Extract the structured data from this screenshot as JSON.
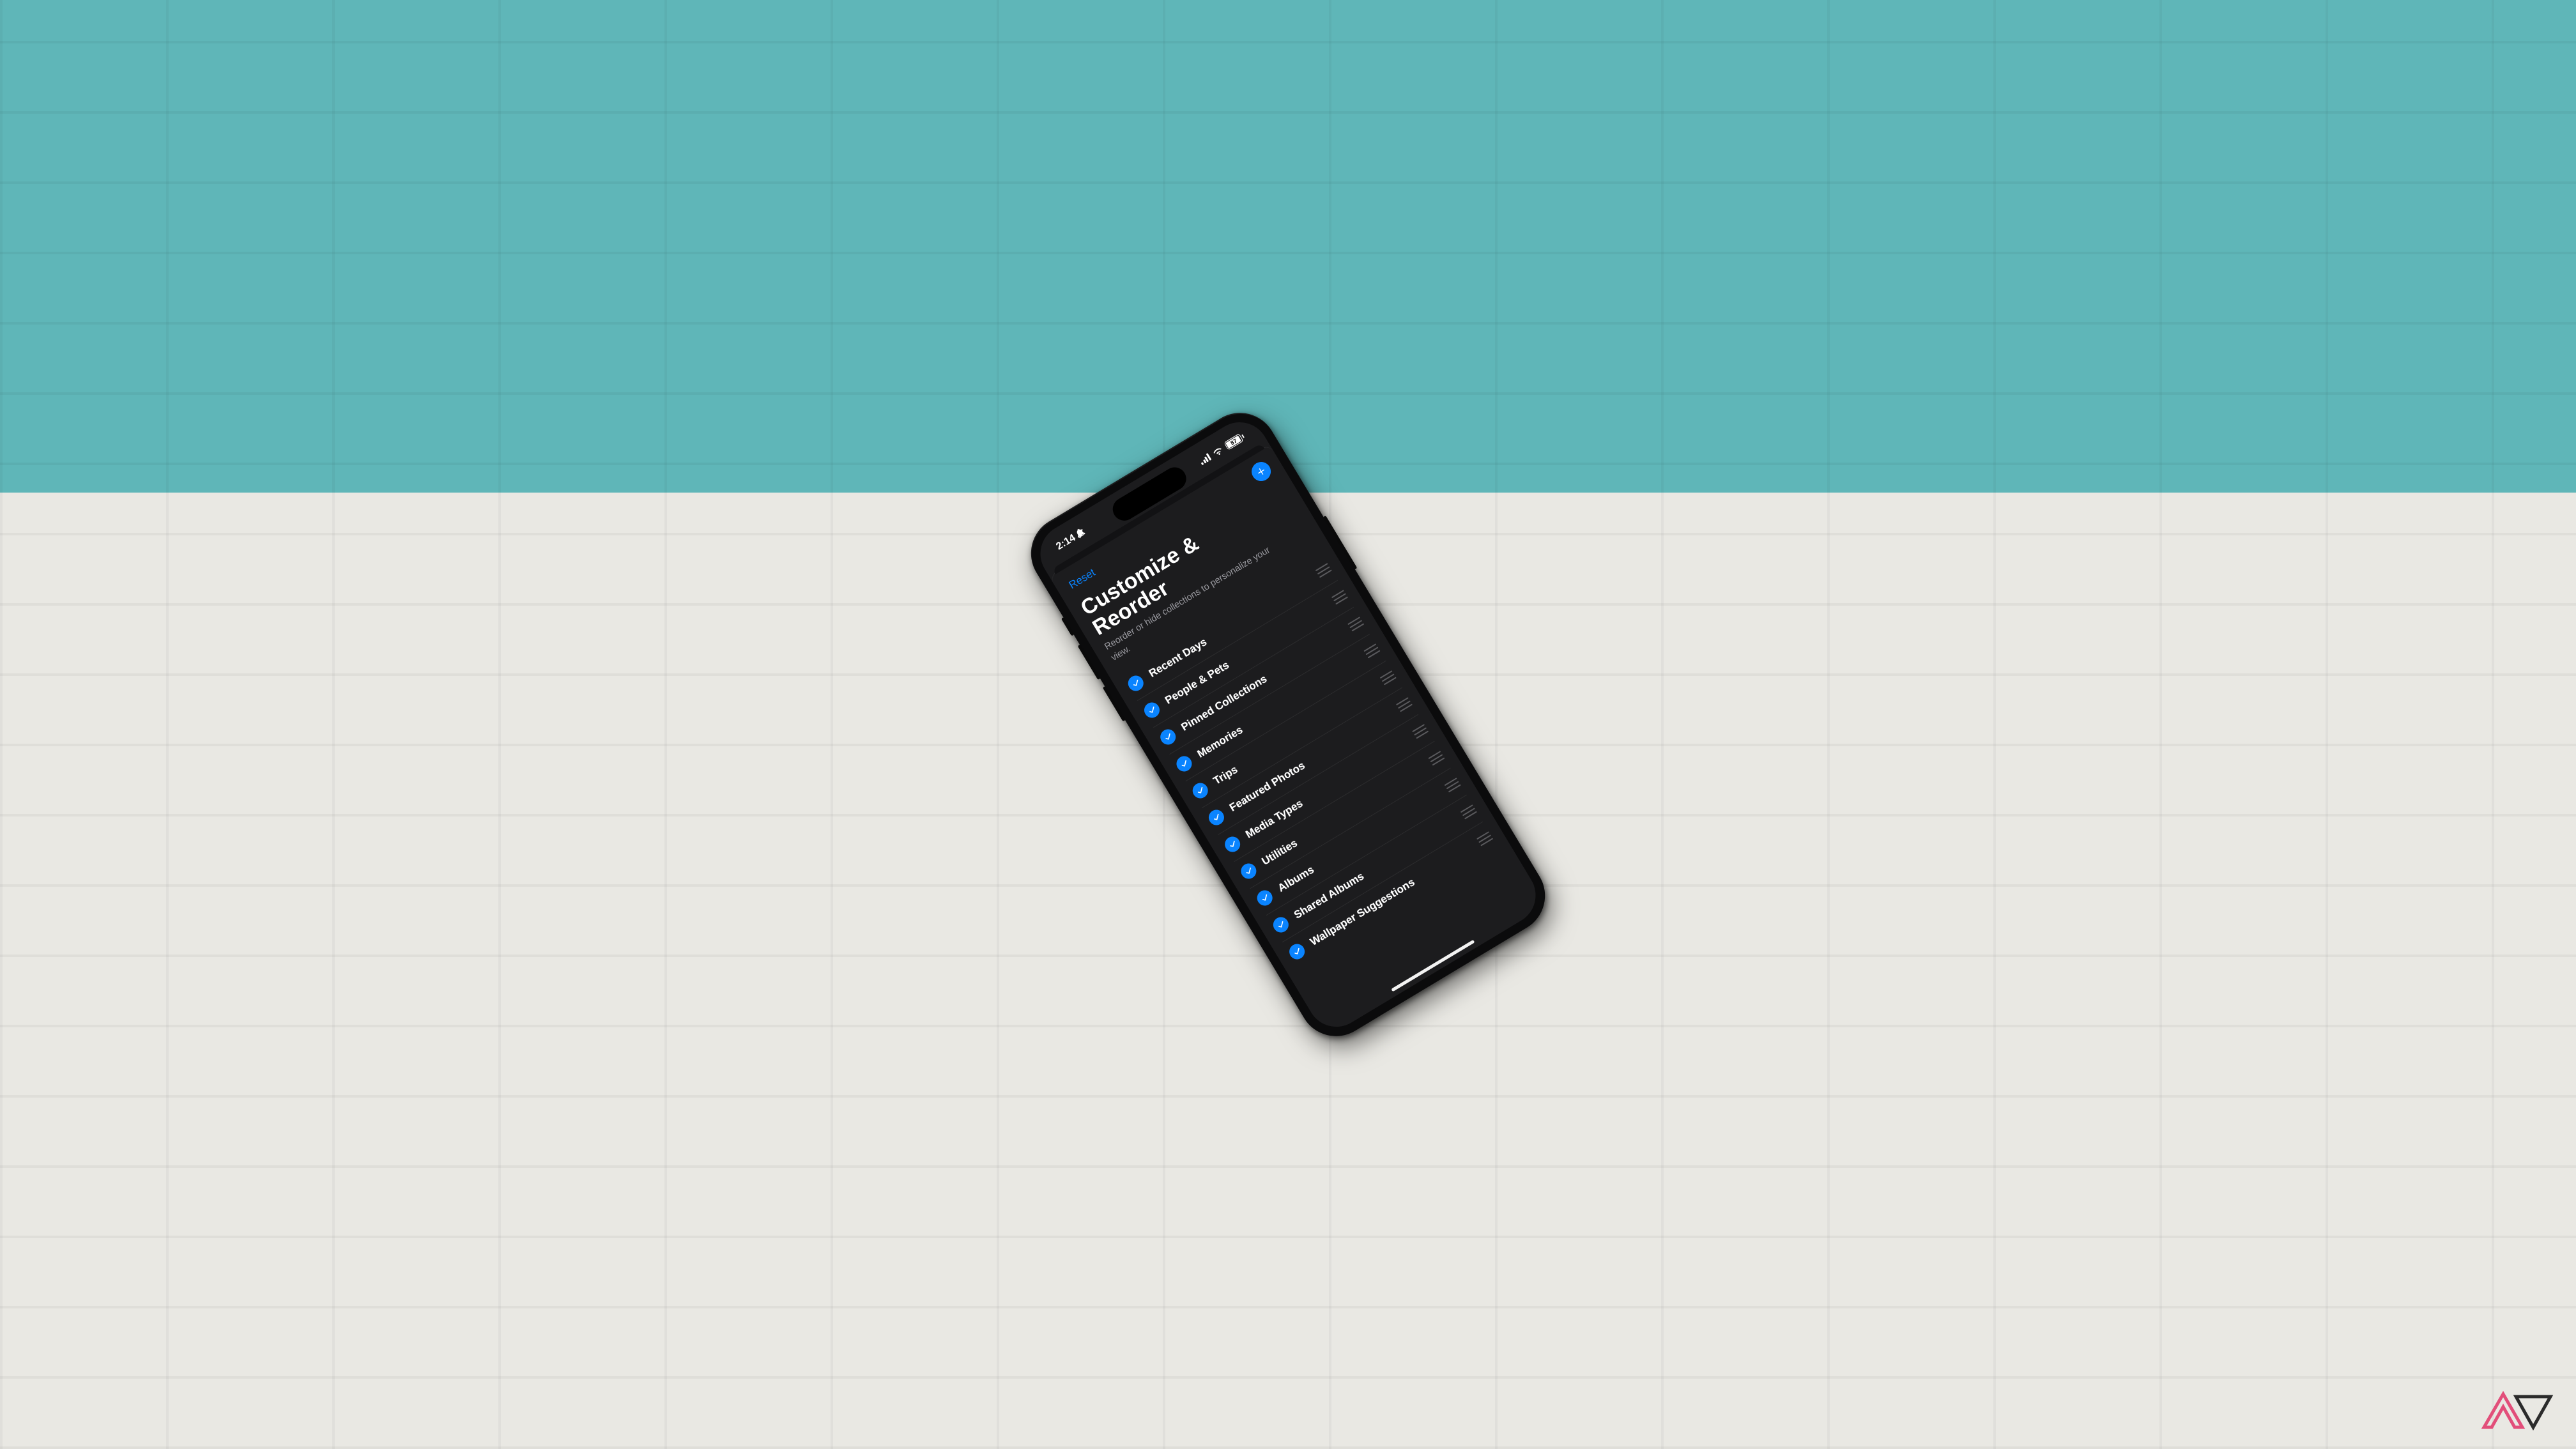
{
  "status": {
    "time": "2:14",
    "silent": true,
    "battery_percent": "87"
  },
  "nav": {
    "reset_label": "Reset"
  },
  "header": {
    "title_line1": "Customize &",
    "title_line2": "Reorder",
    "subtitle": "Reorder or hide collections to personalize your view."
  },
  "items": [
    {
      "label": "Recent Days",
      "checked": true
    },
    {
      "label": "People & Pets",
      "checked": true
    },
    {
      "label": "Pinned Collections",
      "checked": true
    },
    {
      "label": "Memories",
      "checked": true
    },
    {
      "label": "Trips",
      "checked": true
    },
    {
      "label": "Featured Photos",
      "checked": true
    },
    {
      "label": "Media Types",
      "checked": true
    },
    {
      "label": "Utilities",
      "checked": true
    },
    {
      "label": "Albums",
      "checked": true
    },
    {
      "label": "Shared Albums",
      "checked": true
    },
    {
      "label": "Wallpaper Suggestions",
      "checked": true
    }
  ],
  "colors": {
    "accent": "#0a84ff",
    "sheet_bg": "#1c1c1e"
  }
}
